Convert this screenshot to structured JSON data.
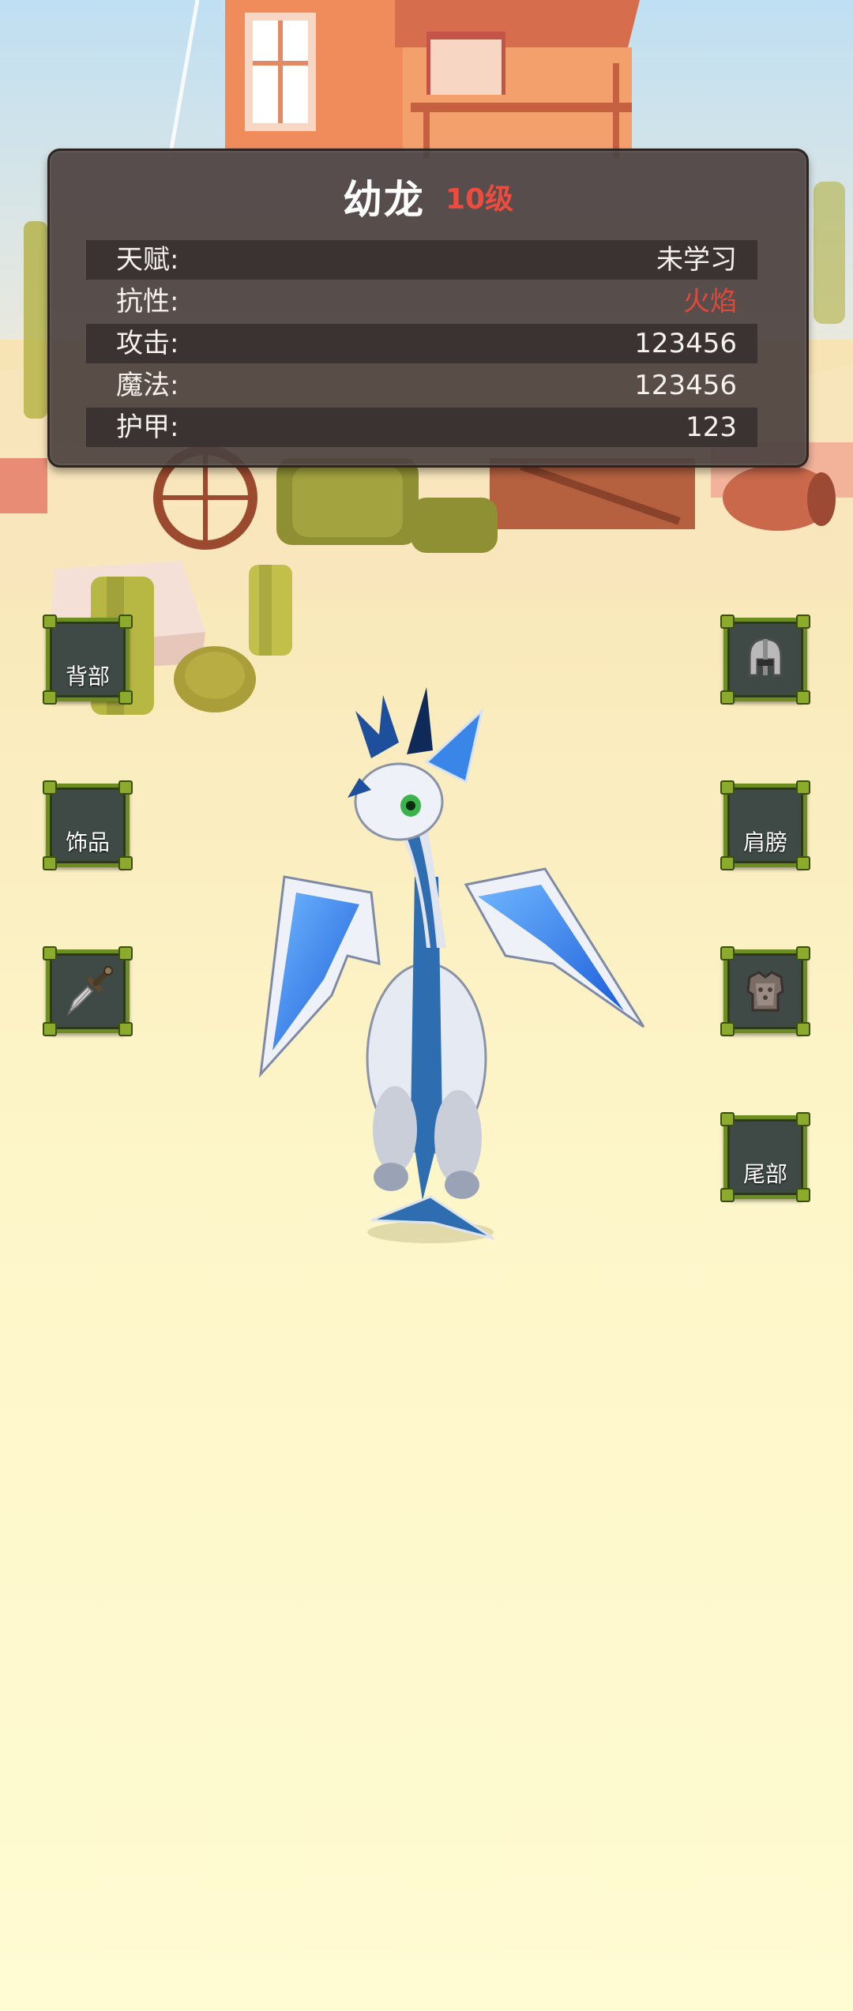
{
  "panel": {
    "name": "幼龙",
    "level": "10级",
    "stats": [
      {
        "label": "天赋:",
        "value": "未学习"
      },
      {
        "label": "抗性:",
        "value": "火焰"
      },
      {
        "label": "攻击:",
        "value": "123456"
      },
      {
        "label": "魔法:",
        "value": "123456"
      },
      {
        "label": "护甲:",
        "value": "123"
      }
    ]
  },
  "slots": {
    "back": "背部",
    "accessory": "饰品",
    "shoulder": "肩膀",
    "tail": "尾部",
    "weapon_icon": "dagger-icon",
    "head_icon": "helmet-icon",
    "chest_icon": "chest-armor-icon"
  },
  "colors": {
    "panel_bg": "#4c423f",
    "level": "#ee4b3f",
    "resistance": "#e0483c",
    "slot_border": "#6e8d21"
  }
}
